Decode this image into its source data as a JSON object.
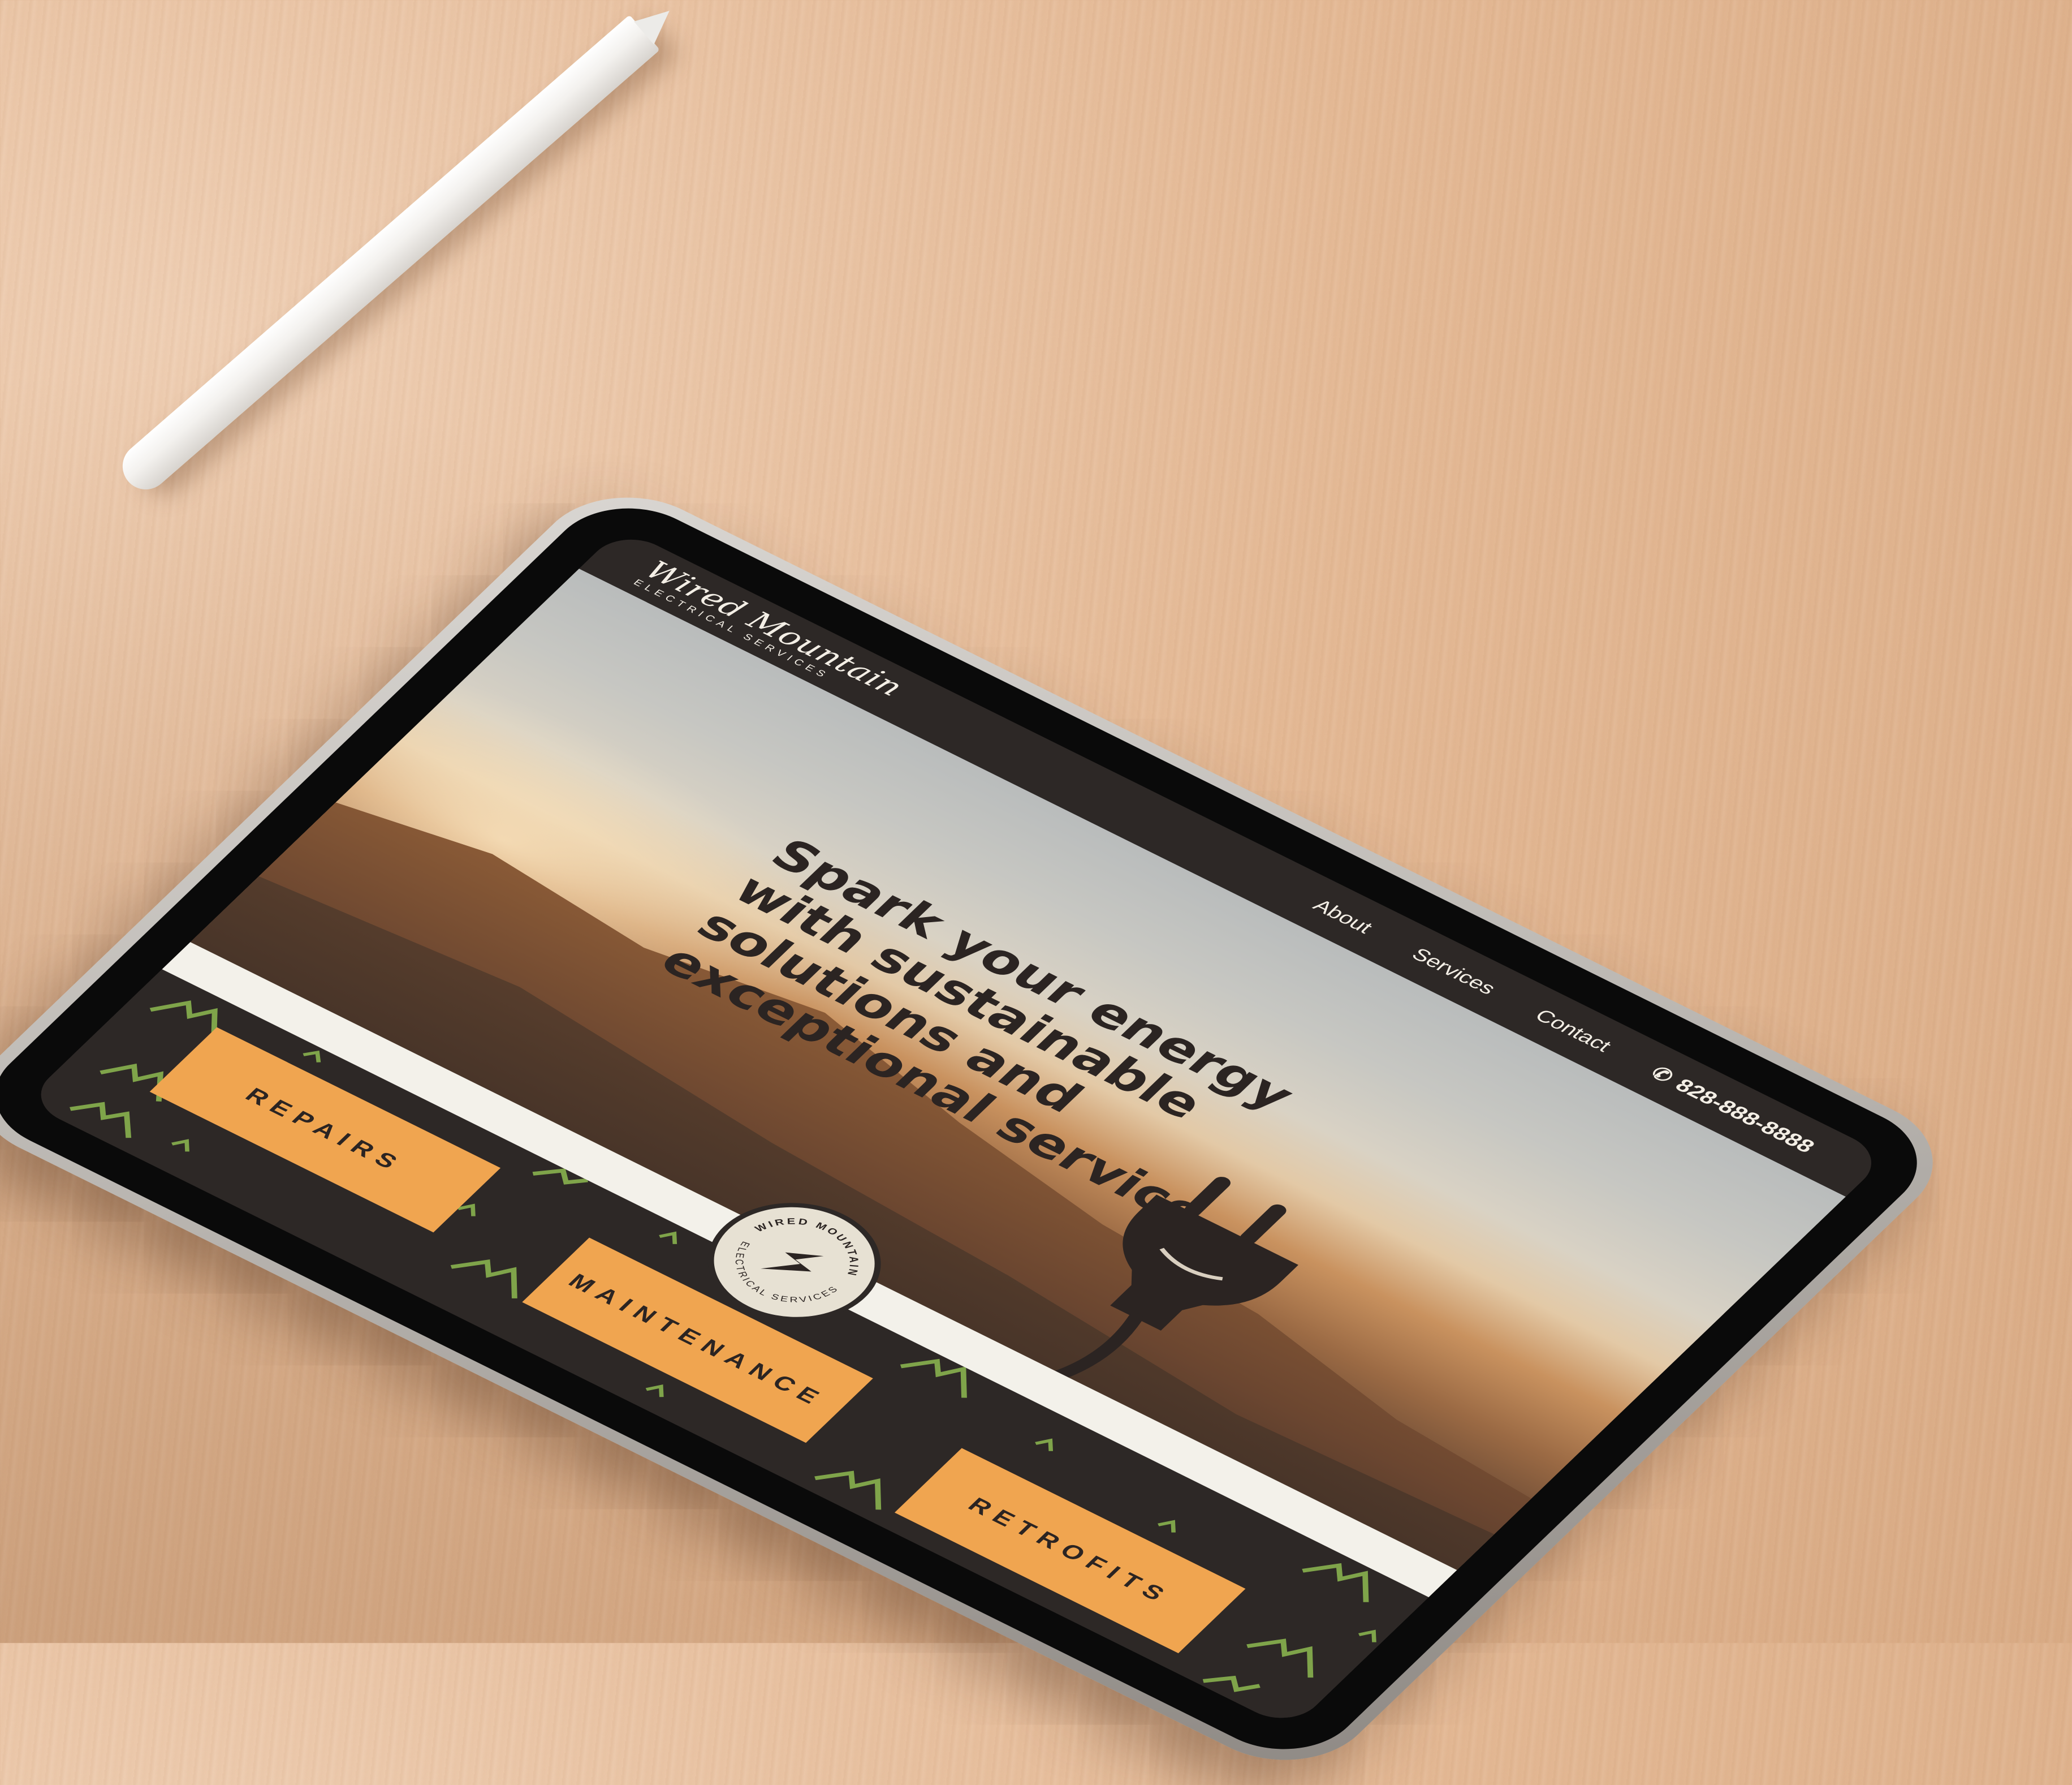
{
  "site": {
    "brand_script": "Wired Mountain",
    "brand_sub": "ELECTRICAL SERVICES",
    "nav": [
      "About",
      "Services",
      "Contact"
    ],
    "phone": "828-888-8888",
    "hero_headline": "Spark your energy with sustainable solutions and exceptional service.",
    "services": [
      "REPAIRS",
      "MAINTENANCE",
      "RETROFITS"
    ],
    "badge_top": "WIRED MOUNTAIN",
    "badge_bottom": "ELECTRICAL SERVICES"
  },
  "colors": {
    "header_bg": "#2d2826",
    "accent_orange": "#f0a550",
    "pattern_green": "#7fa44a",
    "cream": "#f3f1ea",
    "text_dark": "#2b2422"
  },
  "icons": {
    "phone": "phone-icon",
    "plug": "plug-icon",
    "lightning": "lightning-icon",
    "mountains": "mountain-icon"
  }
}
